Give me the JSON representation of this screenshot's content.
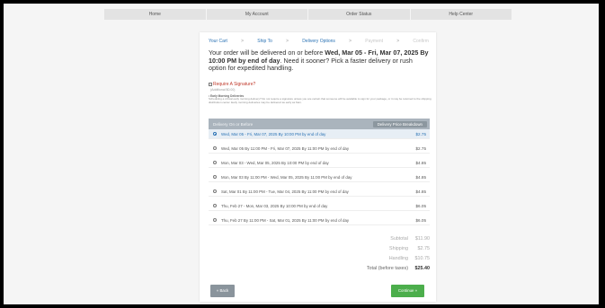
{
  "nav": {
    "items": [
      {
        "label": "Home"
      },
      {
        "label": "My Account"
      },
      {
        "label": "Order Status"
      },
      {
        "label": "Help Center"
      }
    ]
  },
  "steps": {
    "items": [
      {
        "label": "Your Cart",
        "state": "done"
      },
      {
        "label": "Ship To",
        "state": "done"
      },
      {
        "label": "Delivery Options",
        "state": "current"
      },
      {
        "label": "Payment",
        "state": "disabled"
      },
      {
        "label": "Confirm",
        "state": "disabled"
      }
    ],
    "separator": ">"
  },
  "delivery": {
    "prefix": "Your order will be delivered on or before ",
    "dates": "Wed, Mar 05 - Fri, Mar 07, 2025 By 10:00 PM by end of day",
    "suffix": ". Need it sooner? Pick a faster delivery or rush option for expedited handling."
  },
  "signature": {
    "label": "Require A Signature?",
    "price": "(Additional $0.00)"
  },
  "note": {
    "title": "• Early Morning Deliveries",
    "text": "Scheduling a critical early morning delivery? Do not require a signature unless you are certain that someone will be available to sign for your package, or it may be returned to the shipping distribution center. Early morning deliveries may be delivered as early as 6am."
  },
  "table": {
    "header_label": "Delivery On or Before",
    "breakdown_label": "Delivery Price Breakdown",
    "options": [
      {
        "label": "Wed, Mar 05 - Fri, Mar 07, 2025 By 10:00 PM by end of day",
        "price": "$2.75",
        "selected": true
      },
      {
        "label": "Wed, Mar 05 By 11:00 PM - Fri, Mar 07, 2025 By 11:00 PM by end of day",
        "price": "$2.75",
        "selected": false
      },
      {
        "label": "Mon, Mar 03 - Wed, Mar 05, 2025 By 10:00 PM by end of day",
        "price": "$4.85",
        "selected": false
      },
      {
        "label": "Mon, Mar 03 By 11:00 PM - Wed, Mar 05, 2025 By 11:00 PM by end of day",
        "price": "$4.85",
        "selected": false
      },
      {
        "label": "Sat, Mar 01 By 11:00 PM - Tue, Mar 04, 2025 By 11:00 PM by end of day",
        "price": "$4.85",
        "selected": false
      },
      {
        "label": "Thu, Feb 27 - Mon, Mar 03, 2025 By 10:00 PM by end of day",
        "price": "$6.05",
        "selected": false
      },
      {
        "label": "Thu, Feb 27 By 11:00 PM - Sat, Mar 01, 2025 By 11:00 PM by end of day",
        "price": "$6.05",
        "selected": false
      }
    ]
  },
  "totals": {
    "subtotal_label": "Subtotal",
    "subtotal": "$11.90",
    "shipping_label": "Shipping",
    "shipping": "$2.75",
    "handling_label": "Handling",
    "handling": "$10.75",
    "total_label": "Total (before taxes)",
    "total": "$25.40"
  },
  "actions": {
    "back_label": "« Back",
    "continue_label": "Continue »"
  },
  "colors": {
    "link": "#2a72b4",
    "header_bar": "#aab4bd",
    "continue": "#4cae4c",
    "back": "#8a949c",
    "signature": "#c0392b"
  }
}
